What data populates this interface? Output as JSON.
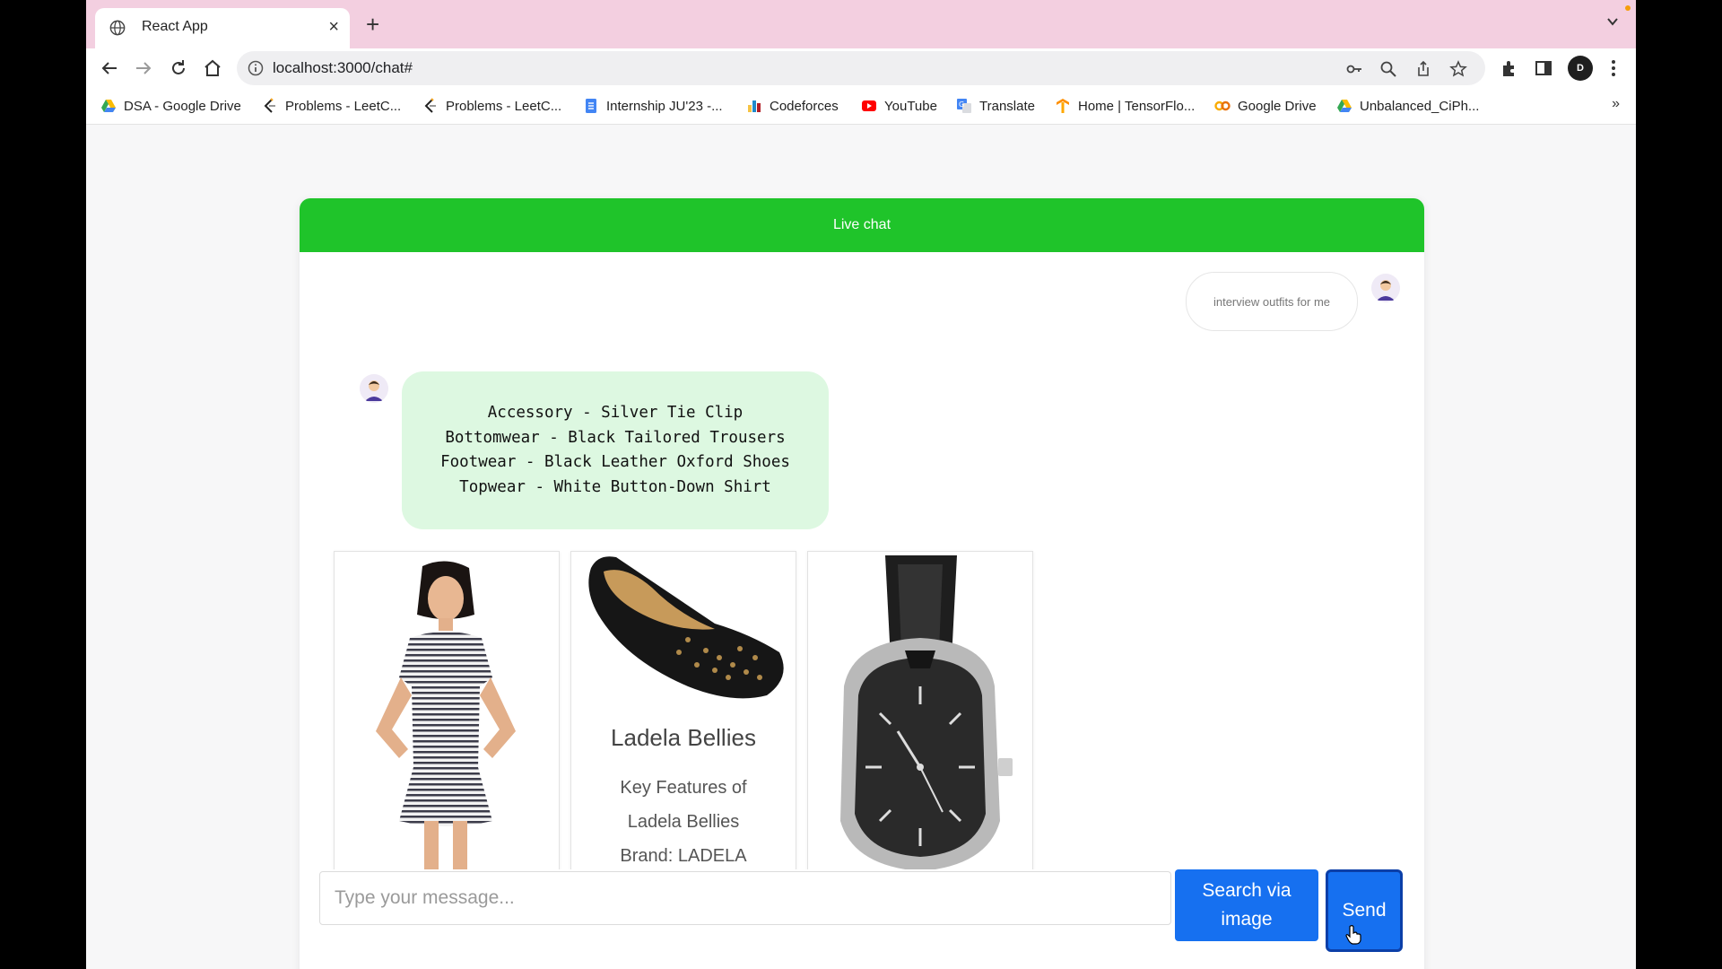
{
  "browser": {
    "tab_title": "React App",
    "tab_close": "×",
    "new_tab": "+",
    "url": "localhost:3000/chat#",
    "profile_initials": "D",
    "bookmarks_more": "»",
    "bookmarks": [
      {
        "label": "DSA - Google Drive",
        "icon": "google-drive-icon"
      },
      {
        "label": "Problems - LeetC...",
        "icon": "leetcode-icon"
      },
      {
        "label": "Problems - LeetC...",
        "icon": "leetcode-icon"
      },
      {
        "label": "Internship JU'23 -...",
        "icon": "google-docs-icon"
      },
      {
        "label": "Codeforces",
        "icon": "codeforces-icon"
      },
      {
        "label": "YouTube",
        "icon": "youtube-icon"
      },
      {
        "label": "Translate",
        "icon": "translate-icon"
      },
      {
        "label": "Home | TensorFlo...",
        "icon": "tensorflow-icon"
      },
      {
        "label": "Google Drive",
        "icon": "colab-icon"
      },
      {
        "label": "Unbalanced_CiPh...",
        "icon": "google-drive-icon"
      }
    ]
  },
  "chat": {
    "header_title": "Live chat",
    "user_message": "interview outfits for me",
    "bot_lines": [
      "Accessory - Silver Tie Clip",
      "Bottomwear - Black Tailored Trousers",
      "Footwear - Black Leather Oxford Shoes",
      "Topwear - White Button-Down Shirt"
    ],
    "products": [
      {
        "image": "striped-dress-image",
        "title": "",
        "desc": []
      },
      {
        "image": "black-studded-bellies-image",
        "title": "Ladela Bellies",
        "desc": [
          "Key Features of",
          "Ladela Bellies",
          "Brand: LADELA"
        ]
      },
      {
        "image": "black-wrist-watch-image",
        "title": "",
        "desc": []
      }
    ],
    "input_placeholder": "Type your message...",
    "search_image_label": "Search via\nimage",
    "send_label": "Send"
  },
  "colors": {
    "header_green": "#1fc42a",
    "bot_bubble": "#ddf8e1",
    "button_blue": "#1670f0",
    "tabstrip_pink": "#f3cfe0"
  }
}
